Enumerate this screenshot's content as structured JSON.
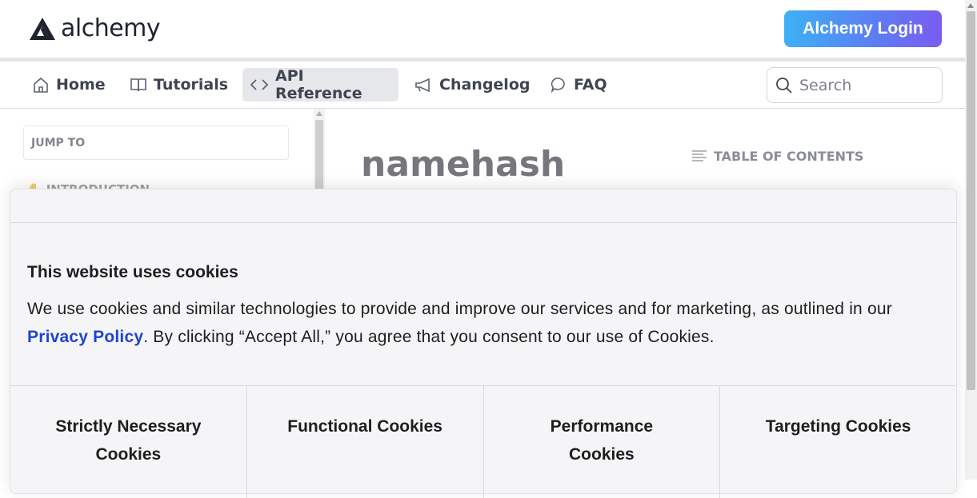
{
  "header": {
    "logo_text": "alchemy",
    "login_label": "Alchemy Login"
  },
  "nav": {
    "items": [
      {
        "label": "Home",
        "icon": "home-icon"
      },
      {
        "label": "Tutorials",
        "icon": "book-icon"
      },
      {
        "label": "API Reference",
        "icon": "code-icon",
        "active": true
      },
      {
        "label": "Changelog",
        "icon": "megaphone-icon"
      },
      {
        "label": "FAQ",
        "icon": "chat-bubble-icon"
      }
    ],
    "search_placeholder": "Search"
  },
  "sidebar": {
    "jump_to": "JUMP TO",
    "first_section": "INTRODUCTION"
  },
  "main": {
    "title": "namehash",
    "toc_label": "TABLE OF CONTENTS"
  },
  "cookie_banner": {
    "title": "This website uses cookies",
    "text_before": "We use cookies and similar technologies to provide and improve our services and for marketing, as outlined in our ",
    "link_text": "Privacy Policy",
    "text_after": ". By clicking “Accept All,” you agree that you consent to our use of Cookies.",
    "categories": [
      "Strictly Necessary Cookies",
      "Functional Cookies",
      "Performance Cookies",
      "Targeting Cookies"
    ]
  },
  "colors": {
    "login_gradient_start": "#3db1f5",
    "login_gradient_end": "#7a5cf0",
    "link": "#1f46c9"
  }
}
